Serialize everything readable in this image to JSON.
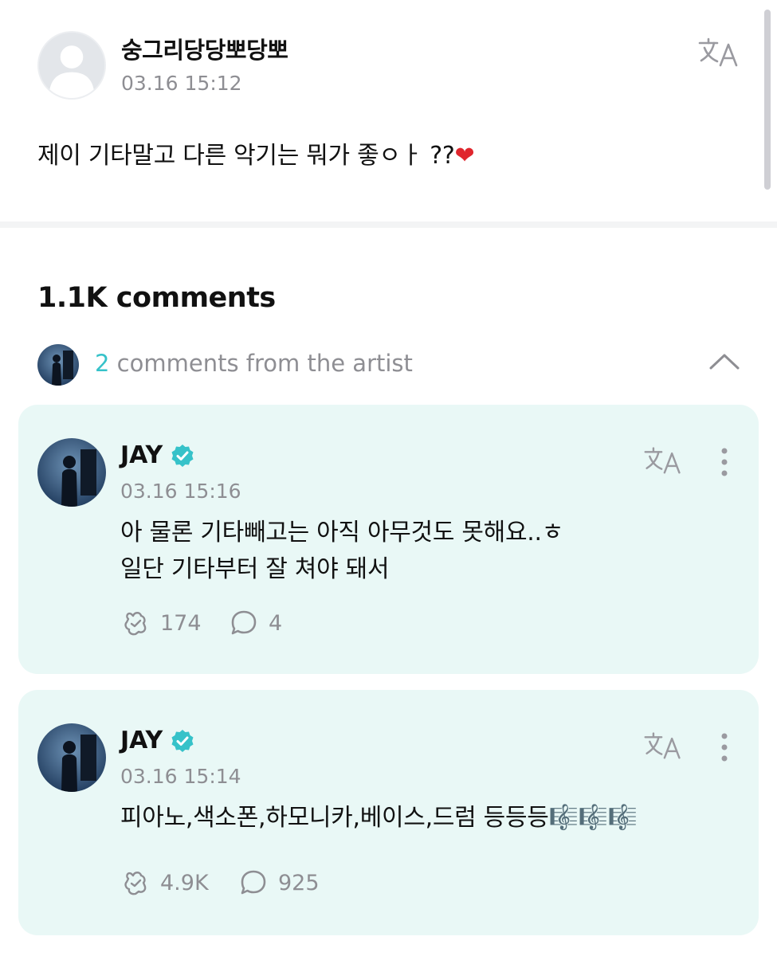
{
  "post": {
    "author": "숭그리당당뽀당뽀",
    "time": "03.16 15:12",
    "text": "제이 기타말고 다른 악기는 뭐가 좋ㅇㅏ ??",
    "heart": "❤"
  },
  "comments_header": {
    "count_label": "1.1K comments"
  },
  "artist_comments": {
    "count": "2",
    "label": " comments from the artist"
  },
  "comments": [
    {
      "author": "JAY",
      "time": "03.16 15:16",
      "lines": [
        "아 물론 기타빼고는 아직 아무것도 못해요..ㅎ",
        "일단 기타부터 잘 쳐야 돼서"
      ],
      "likes": "174",
      "replies": "4"
    },
    {
      "author": "JAY",
      "time": "03.16 15:14",
      "lines": [
        "피아노,색소폰,하모니카,베이스,드럼 등등등🎼🎼🎼"
      ],
      "likes": "4.9K",
      "replies": "925"
    }
  ],
  "colors": {
    "accent": "#36c2c9",
    "card_bg": "#e9f8f6",
    "muted_text": "#8e8e93",
    "heart": "#e0262d"
  },
  "icons": [
    "default-avatar-icon",
    "translate-icon",
    "chevron-up-icon",
    "verified-badge-icon",
    "more-icon",
    "like-icon",
    "reply-icon"
  ]
}
